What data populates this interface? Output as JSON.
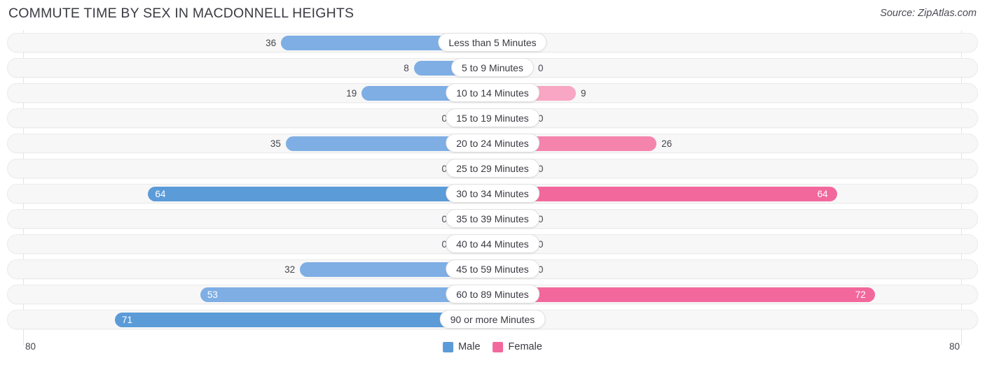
{
  "header": {
    "title": "COMMUTE TIME BY SEX IN MACDONNELL HEIGHTS",
    "source": "Source: ZipAtlas.com"
  },
  "axis": {
    "left_label": "80",
    "right_label": "80",
    "max": 80
  },
  "legend": {
    "items": [
      {
        "label": "Male",
        "color": "#5b9bd8"
      },
      {
        "label": "Female",
        "color": "#f2689c"
      }
    ]
  },
  "colors": {
    "male": "#7eaee4",
    "male_highlight": "#5b9bd8",
    "female": "#f8a6c3",
    "female_mid": "#f584ad",
    "female_highlight": "#f2689c",
    "track": "#f7f7f7",
    "pill": "#ffffff"
  },
  "chart_data": {
    "type": "bar",
    "title": "COMMUTE TIME BY SEX IN MACDONNELL HEIGHTS",
    "subtitle": "",
    "xlabel": "",
    "ylabel": "",
    "orientation": "horizontal-diverging",
    "axis_max": 80,
    "xlim": [
      80,
      80
    ],
    "grid": false,
    "legend_position": "bottom-center",
    "categories": [
      "Less than 5 Minutes",
      "5 to 9 Minutes",
      "10 to 14 Minutes",
      "15 to 19 Minutes",
      "20 to 24 Minutes",
      "25 to 29 Minutes",
      "30 to 34 Minutes",
      "35 to 39 Minutes",
      "40 to 44 Minutes",
      "45 to 59 Minutes",
      "60 to 89 Minutes",
      "90 or more Minutes"
    ],
    "series": [
      {
        "name": "Male",
        "values": [
          36,
          8,
          19,
          0,
          35,
          0,
          64,
          0,
          0,
          32,
          53,
          71
        ]
      },
      {
        "name": "Female",
        "values": [
          0,
          0,
          9,
          0,
          26,
          0,
          64,
          0,
          0,
          0,
          72,
          0
        ]
      }
    ]
  },
  "rows": [
    {
      "category": "Less than 5 Minutes",
      "male": "36",
      "female": "0"
    },
    {
      "category": "5 to 9 Minutes",
      "male": "8",
      "female": "0"
    },
    {
      "category": "10 to 14 Minutes",
      "male": "19",
      "female": "9"
    },
    {
      "category": "15 to 19 Minutes",
      "male": "0",
      "female": "0"
    },
    {
      "category": "20 to 24 Minutes",
      "male": "35",
      "female": "26"
    },
    {
      "category": "25 to 29 Minutes",
      "male": "0",
      "female": "0"
    },
    {
      "category": "30 to 34 Minutes",
      "male": "64",
      "female": "64"
    },
    {
      "category": "35 to 39 Minutes",
      "male": "0",
      "female": "0"
    },
    {
      "category": "40 to 44 Minutes",
      "male": "0",
      "female": "0"
    },
    {
      "category": "45 to 59 Minutes",
      "male": "32",
      "female": "0"
    },
    {
      "category": "60 to 89 Minutes",
      "male": "53",
      "female": "72"
    },
    {
      "category": "90 or more Minutes",
      "male": "71",
      "female": "0"
    }
  ]
}
